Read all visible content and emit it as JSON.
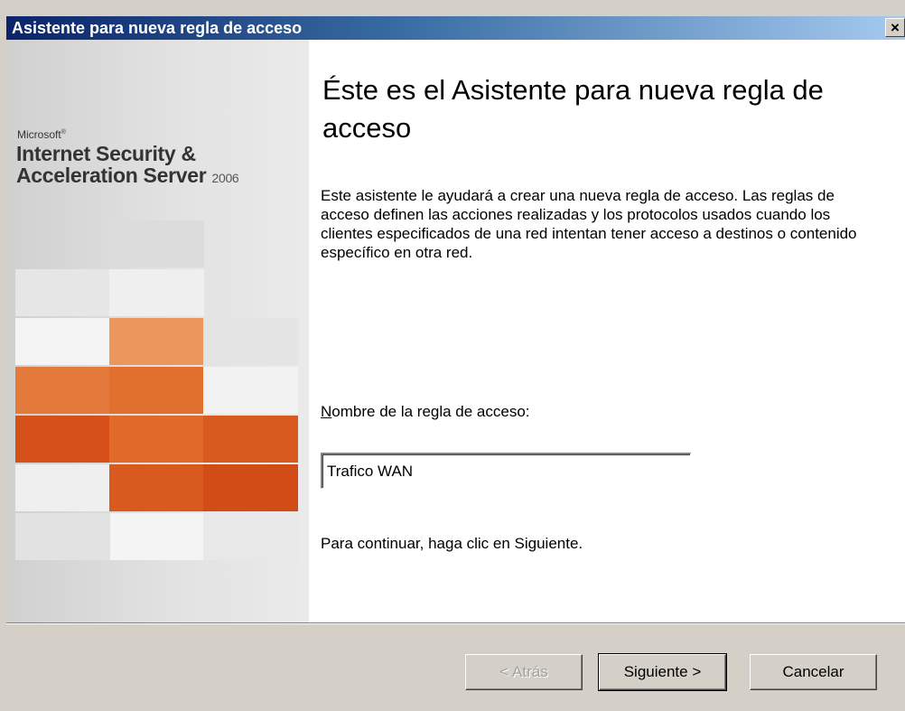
{
  "window": {
    "title": "Asistente para nueva regla de acceso",
    "close_glyph": "×"
  },
  "brand": {
    "company": "Microsoft",
    "trademark": "®",
    "line1": "Internet Security &",
    "line2": "Acceleration Server",
    "year": "2006"
  },
  "main": {
    "title": "Éste es el Asistente para nueva regla de acceso",
    "description": "Este asistente le ayudará a crear una nueva regla de acceso. Las reglas de acceso definen las acciones realizadas y los protocolos usados cuando los clientes especificados de una red intentan tener acceso a destinos o contenido específico en otra red.",
    "field_label_mnemonic": "N",
    "field_label_rest": "ombre de la regla de acceso:",
    "field_value": "Trafico WAN",
    "hint": "Para continuar, haga clic en Siguiente."
  },
  "buttons": {
    "back_label": "< Atrás",
    "back_enabled": false,
    "next_label": "Siguiente >",
    "cancel_label": "Cancelar"
  },
  "colors": {
    "title_bar_start": "#0a246a",
    "title_bar_end": "#a6caf0",
    "dialog_face": "#d4d0c8",
    "tile_orange_dark": "#d6501a",
    "tile_orange_mid": "#e1702f",
    "tile_orange_light": "#ec965e"
  },
  "icons": {
    "close": "close-icon"
  }
}
